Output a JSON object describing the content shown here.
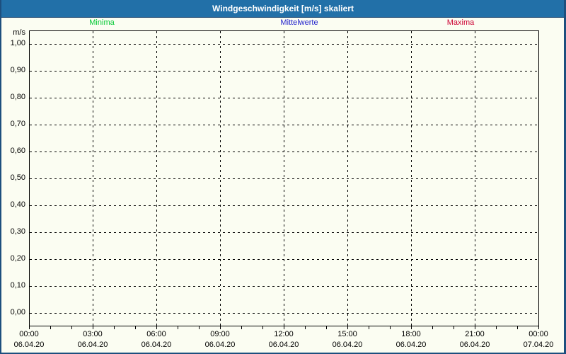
{
  "window": {
    "title": "Windgeschwindigkeit [m/s] skaliert"
  },
  "colors": {
    "title_bar": "#2270A8",
    "title_text": "#FFFFFF",
    "frame": "#1D4F7E",
    "background": "#FBFDF2",
    "grid": "#000000",
    "minima": "#00C832",
    "mittelwerte": "#2222CC",
    "maxima": "#CC0033"
  },
  "chart_data": {
    "type": "line",
    "title": "Windgeschwindigkeit [m/s] skaliert",
    "ylabel": "m/s",
    "xlabel": "",
    "ylim": [
      0.0,
      1.0
    ],
    "y_tick_step": 0.1,
    "y_tick_labels": [
      "1,00",
      "0,90",
      "0,80",
      "0,70",
      "0,60",
      "0,50",
      "0,40",
      "0,30",
      "0,20",
      "0,10",
      "0,00"
    ],
    "x_axis": {
      "major_tick_interval_hours": 3,
      "minor_tick_interval_hours": 1,
      "ticks": [
        {
          "time": "00:00",
          "date": "06.04.20"
        },
        {
          "time": "03:00",
          "date": "06.04.20"
        },
        {
          "time": "06:00",
          "date": "06.04.20"
        },
        {
          "time": "09:00",
          "date": "06.04.20"
        },
        {
          "time": "12:00",
          "date": "06.04.20"
        },
        {
          "time": "15:00",
          "date": "06.04.20"
        },
        {
          "time": "18:00",
          "date": "06.04.20"
        },
        {
          "time": "21:00",
          "date": "06.04.20"
        },
        {
          "time": "00:00",
          "date": "07.04.20"
        }
      ]
    },
    "grid": true,
    "legend_position": "top",
    "series": [
      {
        "name": "Minima",
        "color": "#00C832",
        "values": []
      },
      {
        "name": "Mittelwerte",
        "color": "#2222CC",
        "values": []
      },
      {
        "name": "Maxima",
        "color": "#CC0033",
        "values": []
      }
    ]
  }
}
